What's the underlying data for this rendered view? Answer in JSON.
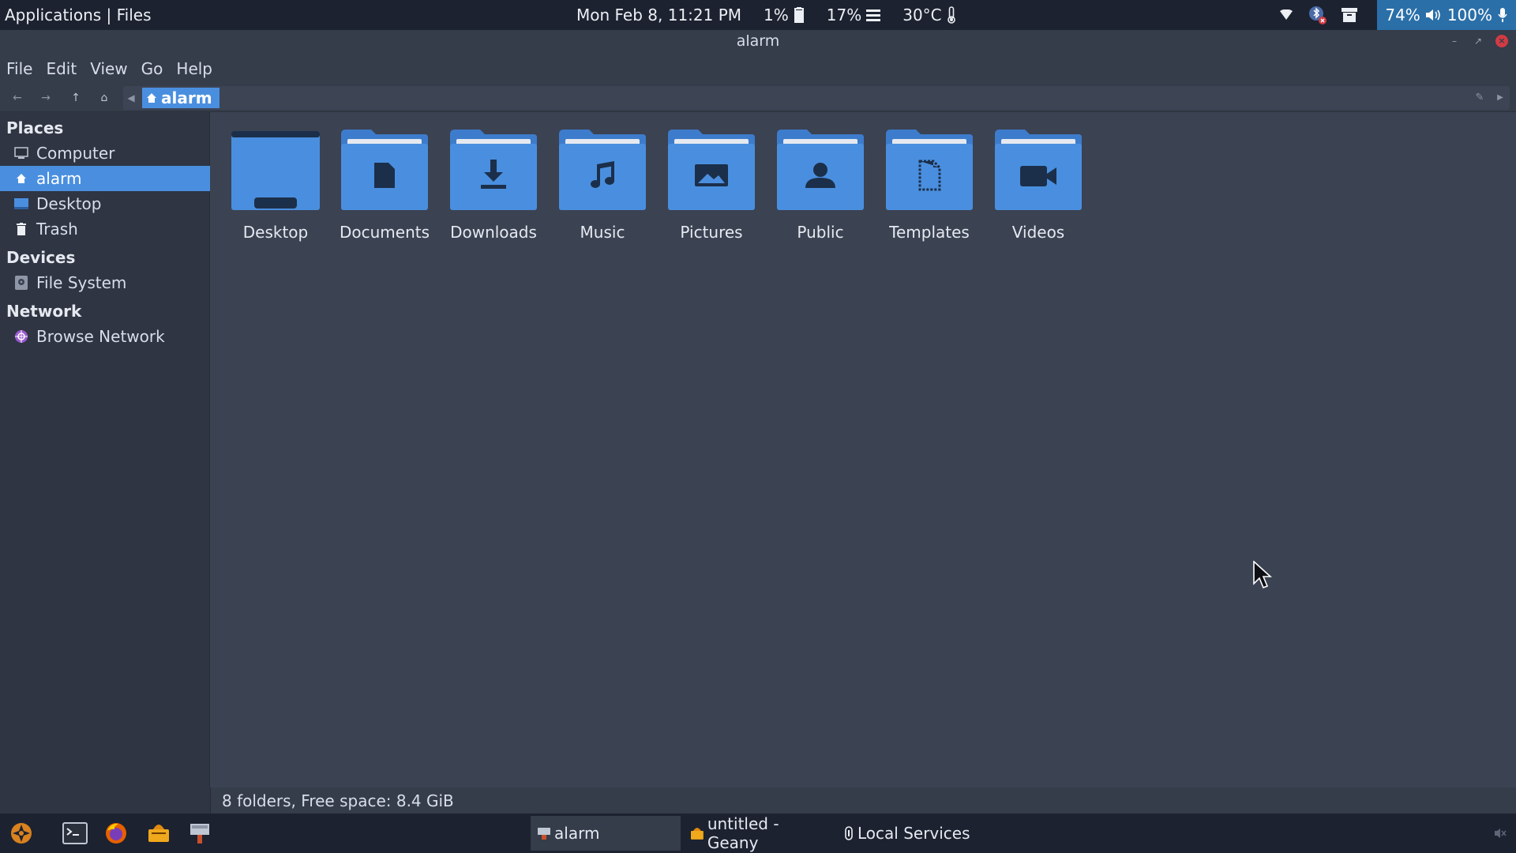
{
  "top_panel": {
    "app_menu": "Applications | Files",
    "datetime": "Mon Feb  8, 11:21 PM",
    "battery_small": "1%",
    "cpu": "17%",
    "temperature": "30°C",
    "battery": "74%",
    "volume": "100%"
  },
  "window": {
    "title": "alarm"
  },
  "menubar": {
    "items": [
      "File",
      "Edit",
      "View",
      "Go",
      "Help"
    ]
  },
  "location": {
    "current": "alarm"
  },
  "sidebar": {
    "places_header": "Places",
    "places": [
      {
        "label": "Computer",
        "icon": "computer-icon"
      },
      {
        "label": "alarm",
        "icon": "home-icon"
      },
      {
        "label": "Desktop",
        "icon": "desktop-icon"
      },
      {
        "label": "Trash",
        "icon": "trash-icon"
      }
    ],
    "devices_header": "Devices",
    "devices": [
      {
        "label": "File System",
        "icon": "drive-icon"
      }
    ],
    "network_header": "Network",
    "network": [
      {
        "label": "Browse Network",
        "icon": "network-icon"
      }
    ]
  },
  "folders": [
    {
      "label": "Desktop",
      "icon": "desktop-folder-icon"
    },
    {
      "label": "Documents",
      "icon": "documents-folder-icon"
    },
    {
      "label": "Downloads",
      "icon": "downloads-folder-icon"
    },
    {
      "label": "Music",
      "icon": "music-folder-icon"
    },
    {
      "label": "Pictures",
      "icon": "pictures-folder-icon"
    },
    {
      "label": "Public",
      "icon": "public-folder-icon"
    },
    {
      "label": "Templates",
      "icon": "templates-folder-icon"
    },
    {
      "label": "Videos",
      "icon": "videos-folder-icon"
    }
  ],
  "statusbar": {
    "text": "8 folders, Free space: 8.4 GiB"
  },
  "taskbar": {
    "tasks": [
      {
        "label": "alarm"
      },
      {
        "label": "untitled - Geany"
      },
      {
        "label": "Local Services"
      }
    ]
  },
  "colors": {
    "accent": "#4a8fdf",
    "folder": "#4a8fdf",
    "folder_dark": "#1c2f4a"
  }
}
